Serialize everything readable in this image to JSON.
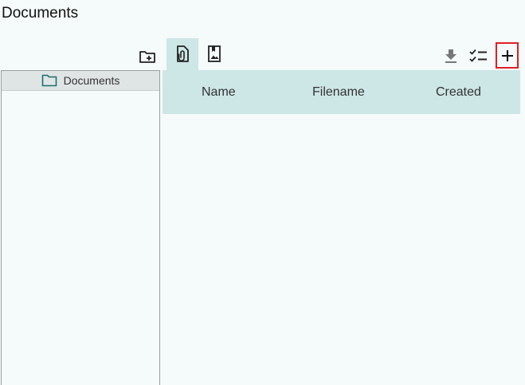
{
  "page": {
    "title": "Documents"
  },
  "toolbar": {
    "new_folder_icon": "create-new-folder-icon",
    "tabs": [
      {
        "icon": "attachment-file-icon",
        "active": true
      },
      {
        "icon": "image-document-icon",
        "active": false
      }
    ],
    "download_icon": "download-icon",
    "checklist_icon": "checklist-icon",
    "add_icon": "plus-icon"
  },
  "folder_tree": {
    "root": {
      "label": "Documents",
      "icon": "folder-icon"
    }
  },
  "table": {
    "columns": [
      "Name",
      "Filename",
      "Created"
    ],
    "rows": []
  },
  "colors": {
    "accent": "#cde6e6",
    "folder_icon": "#1f6e6e",
    "highlight_border": "#e01f26",
    "background": "#f5fafa"
  }
}
